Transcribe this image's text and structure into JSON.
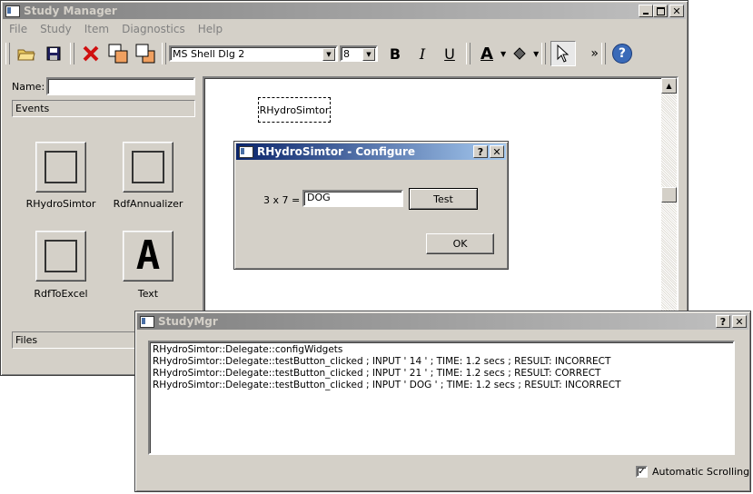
{
  "main_window": {
    "title": "Study Manager",
    "menu": [
      "File",
      "Study",
      "Item",
      "Diagnostics",
      "Help"
    ],
    "toolbar": {
      "font_name": "MS Shell Dlg 2",
      "font_size": "8",
      "bold": "B",
      "italic": "I",
      "underline": "U",
      "more": "»",
      "help": "?"
    },
    "name_label": "Name:",
    "name_value": "",
    "events_header": "Events",
    "palette": [
      {
        "label": "RHydroSimtor",
        "icon": "square-icon"
      },
      {
        "label": "RdfAnnualizer",
        "icon": "square-icon"
      },
      {
        "label": "RdfToExcel",
        "icon": "square-icon"
      },
      {
        "label": "Text",
        "icon": "text-A-icon",
        "glyph": "A"
      }
    ],
    "files_header": "Files",
    "canvas_item": "RHydroSimtor"
  },
  "config_dialog": {
    "title": "RHydroSimtor - Configure",
    "prompt": "3 x 7 =",
    "input_value": "DOG",
    "test_button": "Test",
    "ok_button": "OK",
    "help_btn": "?",
    "close_btn": "✕"
  },
  "log_window": {
    "title": "StudyMgr",
    "lines": [
      "RHydroSimtor::Delegate::configWidgets",
      "RHydroSimtor::Delegate::testButton_clicked ; INPUT ' 14 ' ; TIME:  1.2 secs ; RESULT:  INCORRECT",
      "RHydroSimtor::Delegate::testButton_clicked ; INPUT ' 21 ' ; TIME:  1.2 secs ; RESULT:  CORRECT",
      "RHydroSimtor::Delegate::testButton_clicked ; INPUT ' DOG ' ; TIME:  1.2 secs ; RESULT:  INCORRECT"
    ],
    "auto_scroll_label": "Automatic Scrolling",
    "auto_scroll_checked": true,
    "help_btn": "?",
    "close_btn": "✕"
  }
}
